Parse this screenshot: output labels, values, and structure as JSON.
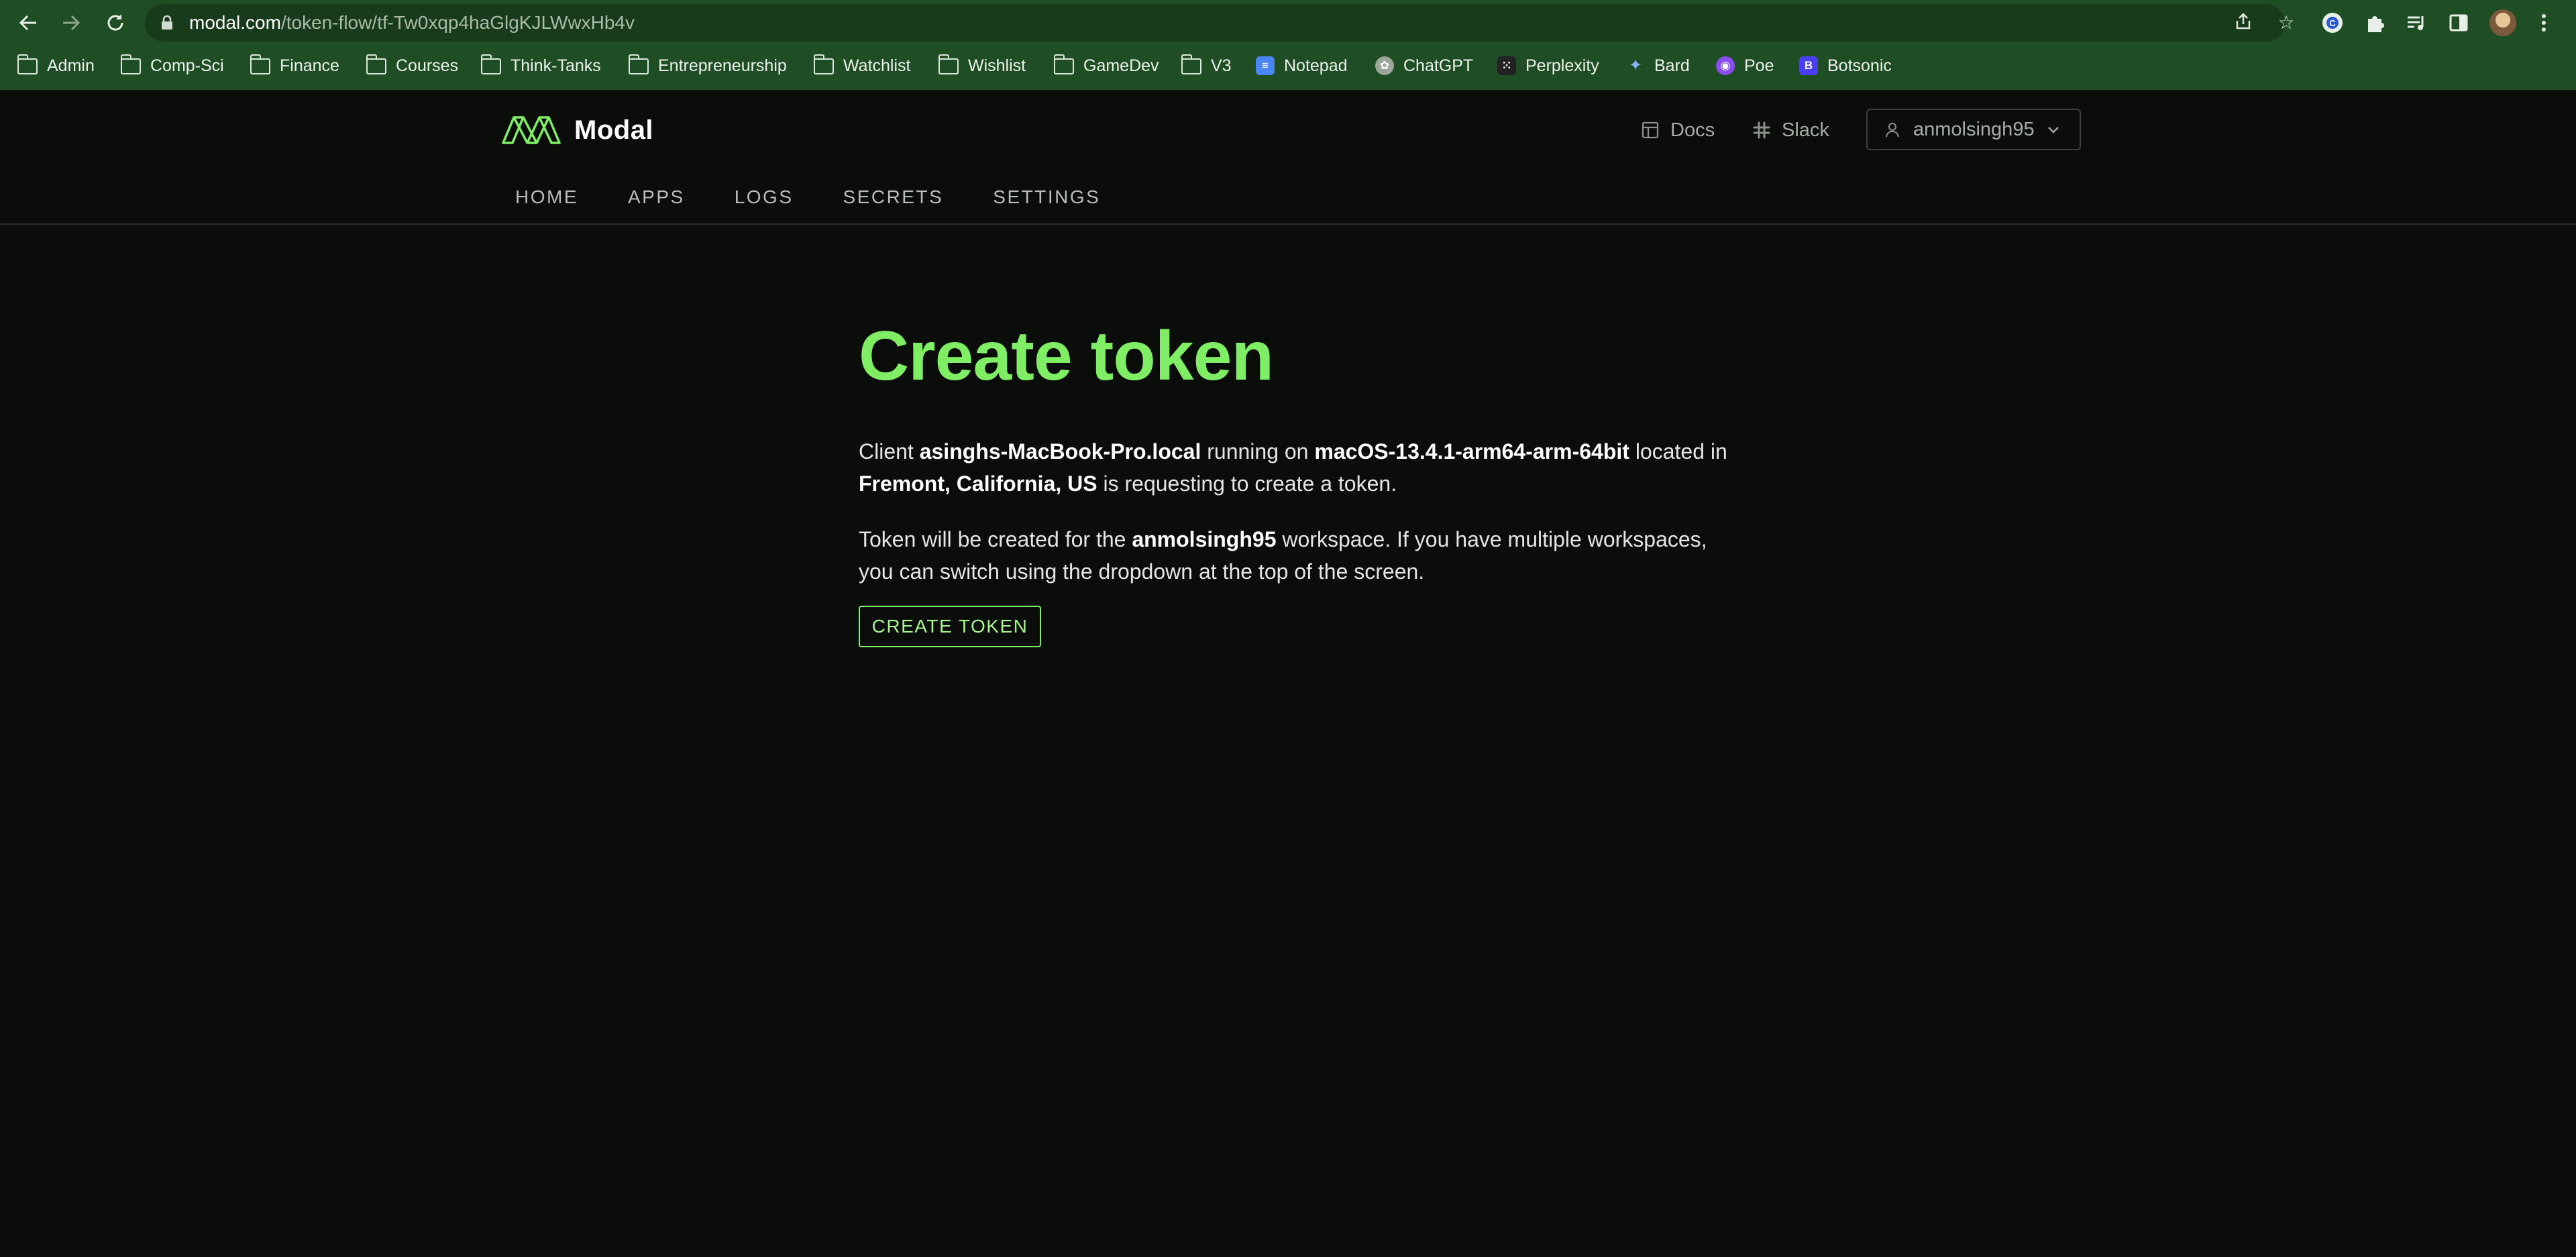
{
  "browser": {
    "url_host": "modal.com",
    "url_path": "/token-flow/tf-Tw0xqp4haGlgKJLWwxHb4v",
    "bookmarks": [
      {
        "label": "Admin",
        "icon": "folder-icon"
      },
      {
        "label": "Comp-Sci",
        "icon": "folder-icon"
      },
      {
        "label": "Finance",
        "icon": "folder-icon"
      },
      {
        "label": "Courses",
        "icon": "folder-icon"
      },
      {
        "label": "Think-Tanks",
        "icon": "folder-icon"
      },
      {
        "label": "Entrepreneurship",
        "icon": "folder-icon"
      },
      {
        "label": "Watchlist",
        "icon": "folder-icon"
      },
      {
        "label": "Wishlist",
        "icon": "folder-icon"
      },
      {
        "label": "GameDev",
        "icon": "folder-icon"
      },
      {
        "label": "V3",
        "icon": "folder-icon"
      },
      {
        "label": "Notepad",
        "icon": "docs-favicon"
      },
      {
        "label": "ChatGPT",
        "icon": "chatgpt-favicon"
      },
      {
        "label": "Perplexity",
        "icon": "perplexity-favicon"
      },
      {
        "label": "Bard",
        "icon": "bard-favicon"
      },
      {
        "label": "Poe",
        "icon": "poe-favicon"
      },
      {
        "label": "Botsonic",
        "icon": "botsonic-favicon"
      }
    ]
  },
  "header": {
    "brand": "Modal",
    "docs_label": "Docs",
    "slack_label": "Slack",
    "user": "anmolsingh95",
    "tabs": [
      "HOME",
      "APPS",
      "LOGS",
      "SECRETS",
      "SETTINGS"
    ]
  },
  "main": {
    "title": "Create token",
    "p1": {
      "t1": "Client ",
      "client": "asinghs-MacBook-Pro.local",
      "t2": " running on ",
      "os": "macOS-13.4.1-arm64-arm-64bit",
      "t3": " located in ",
      "location": "Fremont, California, US",
      "t4": " is requesting to create a token."
    },
    "p2": {
      "t1": "Token will be created for the ",
      "workspace": "anmolsingh95",
      "t2": " workspace. If you have multiple workspaces, you can switch using the dropdown at the top of the screen."
    },
    "button": "CREATE TOKEN"
  },
  "colors": {
    "accent": "#7fee64",
    "background": "#0b0d0b",
    "browser_frame": "#1f4d24"
  }
}
